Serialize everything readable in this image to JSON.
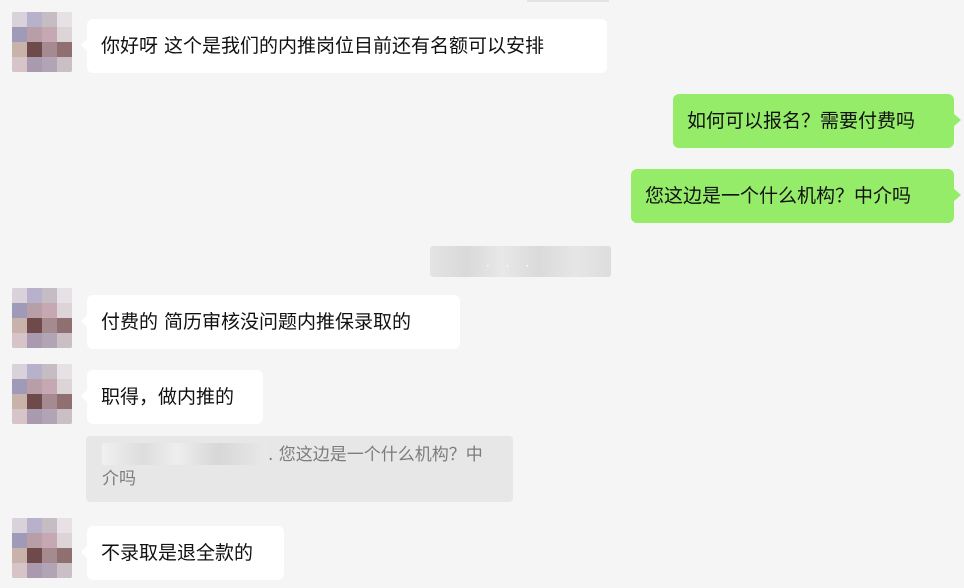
{
  "messages": [
    {
      "side": "in",
      "text": "你好呀 这个是我们的内推岗位目前还有名额可以安排"
    },
    {
      "side": "out",
      "text": "如何可以报名？需要付费吗"
    },
    {
      "side": "out",
      "text": "您这边是一个什么机构？中介吗"
    },
    {
      "side": "in",
      "text": "付费的 简历审核没问题内推保录取的"
    },
    {
      "side": "in",
      "text": "职得，做内推的"
    },
    {
      "side": "in",
      "text": "不录取是退全款的"
    }
  ],
  "quote": {
    "text": ". 您这边是一个什么机构？中介吗"
  },
  "timestamp": {
    "dots": "· · ·"
  },
  "colors": {
    "background": "#f5f5f5",
    "incoming_bubble": "#ffffff",
    "outgoing_bubble": "#95ec69",
    "quote_background": "#e7e7e7"
  }
}
